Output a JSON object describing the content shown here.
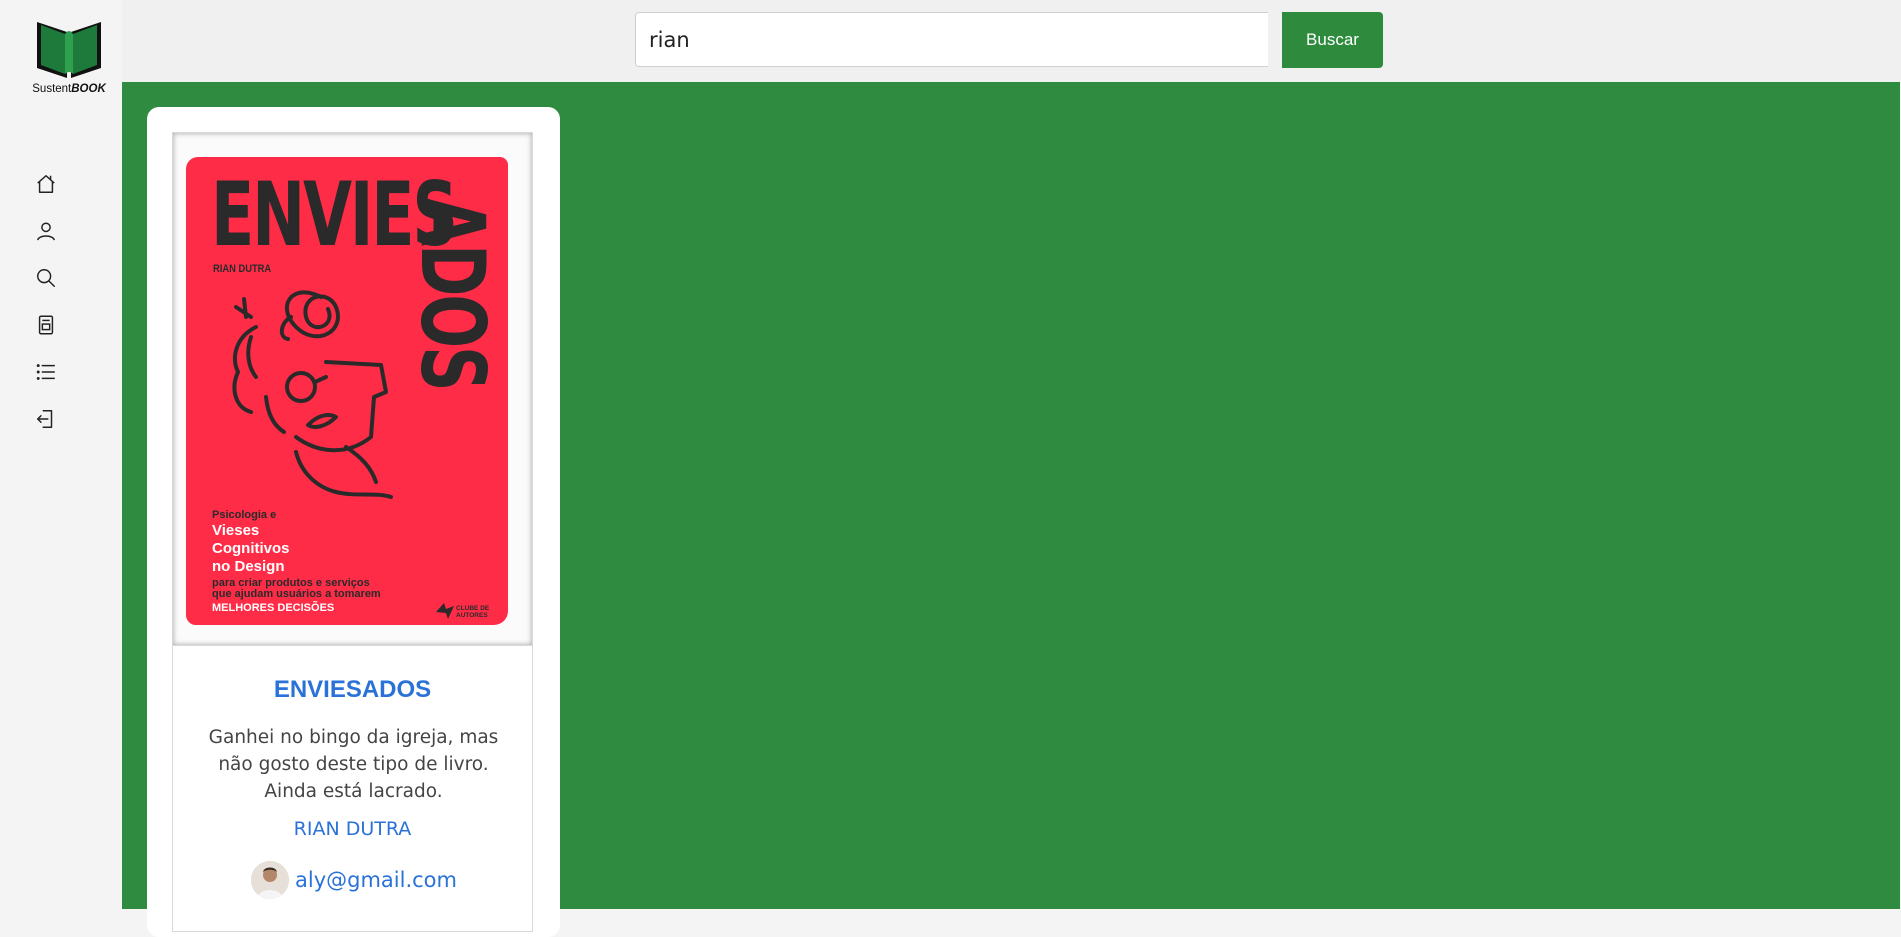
{
  "logo": {
    "brand_prefix": "Sustent",
    "brand_suffix": "BOOK"
  },
  "sidebar": {
    "items": [
      {
        "icon": "home-icon"
      },
      {
        "icon": "user-icon"
      },
      {
        "icon": "search-icon"
      },
      {
        "icon": "book-icon"
      },
      {
        "icon": "list-icon"
      },
      {
        "icon": "logout-icon"
      }
    ]
  },
  "search": {
    "value": "rian",
    "button_label": "Buscar"
  },
  "colors": {
    "accent": "#2e8b3e",
    "link": "#2a72d8",
    "cover": "#ff2c47"
  },
  "results": [
    {
      "cover": {
        "title_top": "ENVIES",
        "title_side": "ADOS",
        "author": "RIAN DUTRA",
        "subtitle_1": "Psicologia e",
        "subtitle_2": "Vieses\nCognitivos\nno Design",
        "subtitle_3": "para criar produtos e serviços\nque ajudam usuários a tomarem",
        "subtitle_4": "MELHORES DECISÕES",
        "publisher": "CLUBE DE AUTORES"
      },
      "title": "ENVIESADOS",
      "description": "Ganhei no bingo da igreja, mas não gosto deste tipo de livro. Ainda está lacrado.",
      "author": "RIAN DUTRA",
      "owner_email": "aly@gmail.com"
    }
  ]
}
